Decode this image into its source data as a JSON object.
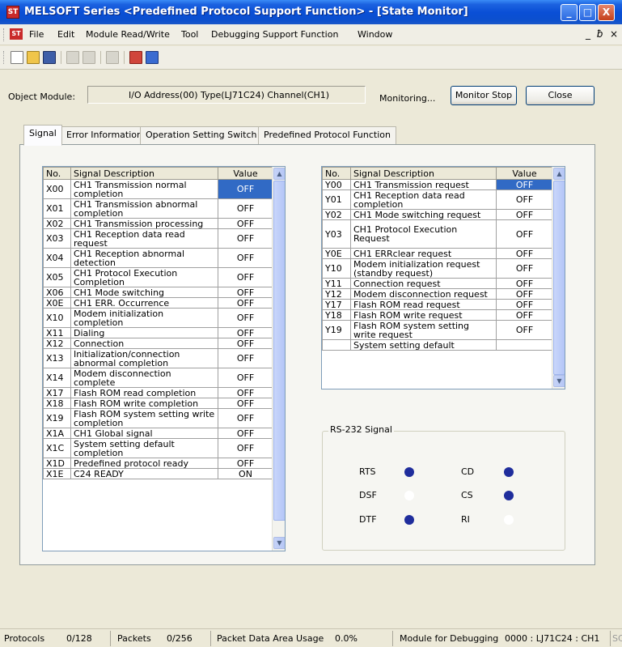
{
  "window": {
    "title": "MELSOFT Series <Predefined Protocol Support Function> - [State Monitor]",
    "app_icon_text": "ST",
    "minimize_glyph": "_",
    "maximize_glyph": "□",
    "close_glyph": "X"
  },
  "menubar": {
    "items": [
      "File",
      "Edit",
      "Module Read/Write",
      "Tool",
      "Debugging Support Function",
      "Window"
    ],
    "doc_minimize_glyph": "_",
    "doc_restore_glyph": "ƀ",
    "doc_close_glyph": "×"
  },
  "object_module": {
    "label": "Object Module:",
    "value": "I/O Address(00) Type(LJ71C24) Channel(CH1)",
    "status": "Monitoring...",
    "monitor_stop": "Monitor Stop",
    "close": "Close"
  },
  "tabs": [
    "Signal",
    "Error Information",
    "Operation Setting Switch",
    "Predefined Protocol Function"
  ],
  "x_table": {
    "headers": [
      "No.",
      "Signal Description",
      "Value"
    ],
    "rows": [
      {
        "no": "X00",
        "desc": "CH1 Transmission normal completion",
        "value": "OFF",
        "selected": true,
        "h": 2
      },
      {
        "no": "X01",
        "desc": "CH1 Transmission abnormal completion",
        "value": "OFF",
        "h": 2
      },
      {
        "no": "X02",
        "desc": "CH1 Transmission processing",
        "value": "OFF",
        "h": 1
      },
      {
        "no": "X03",
        "desc": "CH1 Reception data read request",
        "value": "OFF",
        "h": 2
      },
      {
        "no": "X04",
        "desc": "CH1 Reception abnormal detection",
        "value": "OFF",
        "h": 2
      },
      {
        "no": "X05",
        "desc": "CH1 Protocol Execution Completion",
        "value": "OFF",
        "h": 2
      },
      {
        "no": "X06",
        "desc": "CH1 Mode switching",
        "value": "OFF",
        "h": 1
      },
      {
        "no": "X0E",
        "desc": "CH1 ERR. Occurrence",
        "value": "OFF",
        "h": 1
      },
      {
        "no": "X10",
        "desc": "Modem initialization completion",
        "value": "OFF",
        "h": 2
      },
      {
        "no": "X11",
        "desc": "Dialing",
        "value": "OFF",
        "h": 1
      },
      {
        "no": "X12",
        "desc": "Connection",
        "value": "OFF",
        "h": 1
      },
      {
        "no": "X13",
        "desc": "Initialization/connection abnormal completion",
        "value": "OFF",
        "h": 2
      },
      {
        "no": "X14",
        "desc": "Modem disconnection complete",
        "value": "OFF",
        "h": 2
      },
      {
        "no": "X17",
        "desc": "Flash ROM read completion",
        "value": "OFF",
        "h": 1
      },
      {
        "no": "X18",
        "desc": "Flash ROM write completion",
        "value": "OFF",
        "h": 1
      },
      {
        "no": "X19",
        "desc": "Flash ROM system setting write completion",
        "value": "OFF",
        "h": 2
      },
      {
        "no": "X1A",
        "desc": "CH1 Global signal",
        "value": "OFF",
        "h": 1
      },
      {
        "no": "X1C",
        "desc": "System setting default completion",
        "value": "OFF",
        "h": 2
      },
      {
        "no": "X1D",
        "desc": "Predefined protocol ready",
        "value": "OFF",
        "h": 1
      },
      {
        "no": "X1E",
        "desc": "C24 READY",
        "value": "ON",
        "h": 1
      }
    ]
  },
  "y_table": {
    "headers": [
      "No.",
      "Signal Description",
      "Value"
    ],
    "rows": [
      {
        "no": "Y00",
        "desc": "CH1 Transmission request",
        "value": "OFF",
        "selected": true,
        "h": 1
      },
      {
        "no": "Y01",
        "desc": "CH1 Reception data read completion",
        "value": "OFF",
        "h": 2
      },
      {
        "no": "Y02",
        "desc": "CH1 Mode switching request",
        "value": "OFF",
        "h": 1
      },
      {
        "no": "Y03",
        "desc": "CH1 Protocol Execution Request",
        "value": "OFF",
        "h": 3
      },
      {
        "no": "Y0E",
        "desc": "CH1 ERRclear request",
        "value": "OFF",
        "h": 1
      },
      {
        "no": "Y10",
        "desc": "Modem initialization request (standby request)",
        "value": "OFF",
        "h": 2
      },
      {
        "no": "Y11",
        "desc": "Connection request",
        "value": "OFF",
        "h": 1
      },
      {
        "no": "Y12",
        "desc": "Modem disconnection request",
        "value": "OFF",
        "h": 1
      },
      {
        "no": "Y17",
        "desc": "Flash ROM read request",
        "value": "OFF",
        "h": 1
      },
      {
        "no": "Y18",
        "desc": "Flash ROM write request",
        "value": "OFF",
        "h": 1
      },
      {
        "no": "Y19",
        "desc": "Flash ROM system setting write request",
        "value": "OFF",
        "h": 2
      },
      {
        "no": "",
        "desc": "System setting default",
        "value": "",
        "h": 1
      }
    ]
  },
  "rs232": {
    "title": "RS-232 Signal",
    "signals": [
      {
        "name": "RTS",
        "on": true
      },
      {
        "name": "CD",
        "on": true
      },
      {
        "name": "DSF",
        "on": false
      },
      {
        "name": "CS",
        "on": true
      },
      {
        "name": "DTF",
        "on": true
      },
      {
        "name": "RI",
        "on": false
      }
    ],
    "on_color": "#1f2d9c",
    "off_color": "#ffffff"
  },
  "statusbar": {
    "protocols_label": "Protocols",
    "protocols_value": "0/128",
    "packets_label": "Packets",
    "packets_value": "0/256",
    "area_label": "Packet Data Area Usage",
    "area_value": "0.0%",
    "module_label": "Module for Debugging",
    "module_value": "0000 : LJ71C24 : CH1",
    "trailing": "SC"
  },
  "colors": {
    "titlebar": "#0b4fcf",
    "selection": "#316ac5",
    "face": "#ece9d8"
  }
}
